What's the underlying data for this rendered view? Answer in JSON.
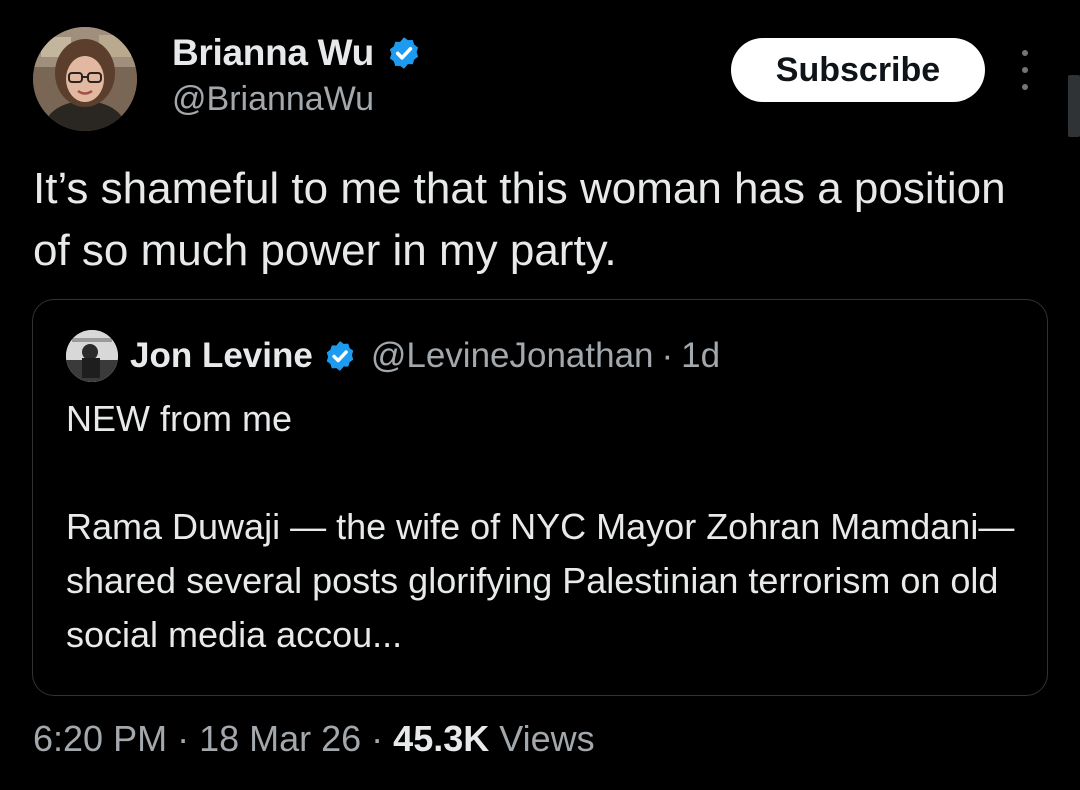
{
  "author": {
    "name": "Brianna Wu",
    "handle": "@BriannaWu",
    "verified": true
  },
  "actions": {
    "subscribe_label": "Subscribe",
    "more_icon": "more-vertical-icon"
  },
  "tweet": {
    "text": "It’s shameful to me that this woman has a position of so much power in my party."
  },
  "quoted_tweet": {
    "author_name": "Jon Levine",
    "author_handle": "@LevineJonathan",
    "separator": "·",
    "time": "1d",
    "verified": true,
    "lines": [
      "NEW from me",
      "Rama Duwaji — the wife of NYC Mayor Zohran Mamdani— shared several posts glorifying Palestinian terrorism on old social media accou..."
    ]
  },
  "meta": {
    "time": "6:20 PM",
    "date": "18 Mar 26",
    "separator": "·",
    "views_count": "45.3K",
    "views_label": "Views"
  },
  "colors": {
    "background": "#000000",
    "text": "#e7e9ea",
    "secondary_text": "#a3a8ad",
    "verified_blue": "#1d9bf0",
    "border": "#2f3336",
    "button_bg": "#ffffff"
  }
}
